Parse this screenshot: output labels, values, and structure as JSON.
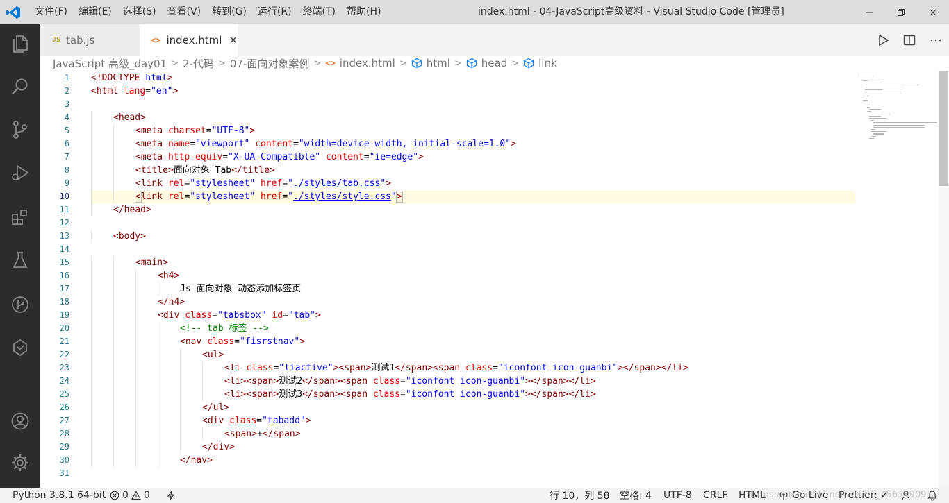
{
  "titlebar": {
    "menu": [
      "文件(F)",
      "编辑(E)",
      "选择(S)",
      "查看(V)",
      "转到(G)",
      "运行(R)",
      "终端(T)",
      "帮助(H)"
    ],
    "window_title": "index.html - 04-JavaScript高级资料 - Visual Studio Code [管理员]",
    "accent": "#0078d7"
  },
  "tabs": [
    {
      "badge": "JS",
      "label": "tab.js",
      "active": false
    },
    {
      "badge": "<>",
      "label": "index.html",
      "active": true,
      "close": "✕"
    }
  ],
  "breadcrumb": {
    "items": [
      "JavaScript 高级_day01",
      "2-代码",
      "07-面向对象案例",
      "index.html",
      "html",
      "head",
      "link"
    ],
    "separator": ">"
  },
  "editor": {
    "lines": [
      {
        "n": "1",
        "ind": 0,
        "t": [
          [
            "tag",
            "<!DOCTYPE "
          ],
          [
            "str",
            "html"
          ],
          [
            "tag",
            ">"
          ]
        ]
      },
      {
        "n": "2",
        "ind": 0,
        "t": [
          [
            "tag",
            "<html "
          ],
          [
            "attr",
            "lang"
          ],
          [
            "txt",
            "="
          ],
          [
            "str",
            "\"en\""
          ],
          [
            "tag",
            ">"
          ]
        ]
      },
      {
        "n": "3",
        "ind": 0,
        "t": []
      },
      {
        "n": "4",
        "ind": 1,
        "t": [
          [
            "tag",
            "<head>"
          ]
        ]
      },
      {
        "n": "5",
        "ind": 2,
        "t": [
          [
            "tag",
            "<meta "
          ],
          [
            "attr",
            "charset"
          ],
          [
            "txt",
            "="
          ],
          [
            "str",
            "\"UTF-8\""
          ],
          [
            "tag",
            ">"
          ]
        ]
      },
      {
        "n": "6",
        "ind": 2,
        "t": [
          [
            "tag",
            "<meta "
          ],
          [
            "attr",
            "name"
          ],
          [
            "txt",
            "="
          ],
          [
            "str",
            "\"viewport\""
          ],
          [
            "txt",
            " "
          ],
          [
            "attr",
            "content"
          ],
          [
            "txt",
            "="
          ],
          [
            "str",
            "\"width=device-width, initial-scale=1.0\""
          ],
          [
            "tag",
            ">"
          ]
        ]
      },
      {
        "n": "7",
        "ind": 2,
        "t": [
          [
            "tag",
            "<meta "
          ],
          [
            "attr",
            "http-equiv"
          ],
          [
            "txt",
            "="
          ],
          [
            "str",
            "\"X-UA-Compatible\""
          ],
          [
            "txt",
            " "
          ],
          [
            "attr",
            "content"
          ],
          [
            "txt",
            "="
          ],
          [
            "str",
            "\"ie=edge\""
          ],
          [
            "tag",
            ">"
          ]
        ]
      },
      {
        "n": "8",
        "ind": 2,
        "t": [
          [
            "tag",
            "<title>"
          ],
          [
            "txt",
            "面向对象 Tab"
          ],
          [
            "tag",
            "</title>"
          ]
        ]
      },
      {
        "n": "9",
        "ind": 2,
        "t": [
          [
            "tag",
            "<link "
          ],
          [
            "attr",
            "rel"
          ],
          [
            "txt",
            "="
          ],
          [
            "str",
            "\"stylesheet\""
          ],
          [
            "txt",
            " "
          ],
          [
            "attr",
            "href"
          ],
          [
            "txt",
            "="
          ],
          [
            "str",
            "\""
          ],
          [
            "ul",
            "./styles/tab.css"
          ],
          [
            "str",
            "\""
          ],
          [
            "tag",
            ">"
          ]
        ]
      },
      {
        "n": "10",
        "ind": 2,
        "t": [
          [
            "box",
            "<"
          ],
          [
            "tag",
            "link "
          ],
          [
            "attr",
            "rel"
          ],
          [
            "txt",
            "="
          ],
          [
            "str",
            "\"stylesheet\""
          ],
          [
            "txt",
            " "
          ],
          [
            "attr",
            "href"
          ],
          [
            "txt",
            "="
          ],
          [
            "str",
            "\""
          ],
          [
            "ul",
            "./styles/style.css"
          ],
          [
            "str",
            "\""
          ],
          [
            "box",
            ">"
          ]
        ]
      },
      {
        "n": "11",
        "ind": 1,
        "t": [
          [
            "tag",
            "</head>"
          ]
        ]
      },
      {
        "n": "12",
        "ind": 0,
        "t": []
      },
      {
        "n": "13",
        "ind": 1,
        "t": [
          [
            "tag",
            "<body>"
          ]
        ]
      },
      {
        "n": "14",
        "ind": 0,
        "t": []
      },
      {
        "n": "15",
        "ind": 2,
        "t": [
          [
            "tag",
            "<main>"
          ]
        ]
      },
      {
        "n": "16",
        "ind": 3,
        "t": [
          [
            "tag",
            "<h4>"
          ]
        ]
      },
      {
        "n": "17",
        "ind": 4,
        "t": [
          [
            "txt",
            "Js 面向对象 动态添加标签页"
          ]
        ]
      },
      {
        "n": "18",
        "ind": 3,
        "t": [
          [
            "tag",
            "</h4>"
          ]
        ]
      },
      {
        "n": "19",
        "ind": 3,
        "t": [
          [
            "tag",
            "<div "
          ],
          [
            "attr",
            "class"
          ],
          [
            "txt",
            "="
          ],
          [
            "str",
            "\"tabsbox\""
          ],
          [
            "txt",
            " "
          ],
          [
            "attr",
            "id"
          ],
          [
            "txt",
            "="
          ],
          [
            "str",
            "\"tab\""
          ],
          [
            "tag",
            ">"
          ]
        ]
      },
      {
        "n": "20",
        "ind": 4,
        "t": [
          [
            "cmt",
            "<!-- tab 标签 -->"
          ]
        ]
      },
      {
        "n": "21",
        "ind": 4,
        "t": [
          [
            "tag",
            "<nav "
          ],
          [
            "attr",
            "class"
          ],
          [
            "txt",
            "="
          ],
          [
            "str",
            "\"fisrstnav\""
          ],
          [
            "tag",
            ">"
          ]
        ]
      },
      {
        "n": "22",
        "ind": 5,
        "t": [
          [
            "tag",
            "<ul>"
          ]
        ]
      },
      {
        "n": "23",
        "ind": 6,
        "t": [
          [
            "tag",
            "<li "
          ],
          [
            "attr",
            "class"
          ],
          [
            "txt",
            "="
          ],
          [
            "str",
            "\"liactive\""
          ],
          [
            "tag",
            "><span>"
          ],
          [
            "txt",
            "测试1"
          ],
          [
            "tag",
            "</span><span "
          ],
          [
            "attr",
            "class"
          ],
          [
            "txt",
            "="
          ],
          [
            "str",
            "\"iconfont icon-guanbi\""
          ],
          [
            "tag",
            "></span></li>"
          ]
        ]
      },
      {
        "n": "24",
        "ind": 6,
        "t": [
          [
            "tag",
            "<li><span>"
          ],
          [
            "txt",
            "测试2"
          ],
          [
            "tag",
            "</span><span "
          ],
          [
            "attr",
            "class"
          ],
          [
            "txt",
            "="
          ],
          [
            "str",
            "\"iconfont icon-guanbi\""
          ],
          [
            "tag",
            "></span></li>"
          ]
        ]
      },
      {
        "n": "25",
        "ind": 6,
        "t": [
          [
            "tag",
            "<li><span>"
          ],
          [
            "txt",
            "测试3"
          ],
          [
            "tag",
            "</span><span "
          ],
          [
            "attr",
            "class"
          ],
          [
            "txt",
            "="
          ],
          [
            "str",
            "\"iconfont icon-guanbi\""
          ],
          [
            "tag",
            "></span></li>"
          ]
        ]
      },
      {
        "n": "26",
        "ind": 5,
        "t": [
          [
            "tag",
            "</ul>"
          ]
        ]
      },
      {
        "n": "27",
        "ind": 5,
        "t": [
          [
            "tag",
            "<div "
          ],
          [
            "attr",
            "class"
          ],
          [
            "txt",
            "="
          ],
          [
            "str",
            "\"tabadd\""
          ],
          [
            "tag",
            ">"
          ]
        ]
      },
      {
        "n": "28",
        "ind": 6,
        "t": [
          [
            "tag",
            "<span>"
          ],
          [
            "txt",
            "+"
          ],
          [
            "tag",
            "</span>"
          ]
        ]
      },
      {
        "n": "29",
        "ind": 5,
        "t": [
          [
            "tag",
            "</div>"
          ]
        ]
      },
      {
        "n": "30",
        "ind": 4,
        "t": [
          [
            "tag",
            "</nav>"
          ]
        ]
      },
      {
        "n": "31",
        "ind": 0,
        "t": []
      }
    ],
    "active_line": "10"
  },
  "statusbar": {
    "python": "Python 3.8.1 64-bit",
    "errors": "0",
    "warnings": "0",
    "position": "行 10，列 58",
    "spaces": "空格: 4",
    "encoding": "UTF-8",
    "eol": "CRLF",
    "language": "HTML",
    "golive": "Go Live",
    "prettier": "Prettier: ✓",
    "watermark": "https://blog.csdn.net/weixin_45638909"
  }
}
